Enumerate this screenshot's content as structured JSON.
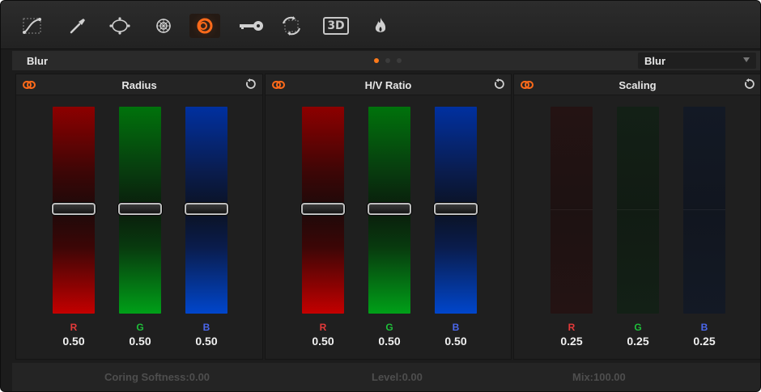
{
  "toolbar": {
    "tools": [
      {
        "icon": "curves-icon"
      },
      {
        "icon": "qualifier-picker-icon"
      },
      {
        "icon": "power-window-icon"
      },
      {
        "icon": "tracker-icon"
      },
      {
        "icon": "blur-icon",
        "active": true
      },
      {
        "icon": "key-icon"
      },
      {
        "icon": "sizing-icon"
      },
      {
        "icon": "3d-icon",
        "label": "3D"
      },
      {
        "icon": "flame-icon"
      }
    ],
    "active_color": "#ff6a1a"
  },
  "header": {
    "title": "Blur",
    "page_dots": 3,
    "active_dot": 0,
    "mode": "Blur"
  },
  "panels": [
    {
      "title": "Radius",
      "channels": [
        {
          "letter": "R",
          "value": "0.50"
        },
        {
          "letter": "G",
          "value": "0.50"
        },
        {
          "letter": "B",
          "value": "0.50"
        }
      ],
      "handle_level": 0.5,
      "enabled": true
    },
    {
      "title": "H/V Ratio",
      "channels": [
        {
          "letter": "R",
          "value": "0.50"
        },
        {
          "letter": "G",
          "value": "0.50"
        },
        {
          "letter": "B",
          "value": "0.50"
        }
      ],
      "handle_level": 0.5,
      "enabled": true
    },
    {
      "title": "Scaling",
      "channels": [
        {
          "letter": "R",
          "value": "0.25"
        },
        {
          "letter": "G",
          "value": "0.25"
        },
        {
          "letter": "B",
          "value": "0.25"
        }
      ],
      "enabled": false
    }
  ],
  "footer": {
    "coring_softness": "Coring Softness:0.00",
    "level": "Level:0.00",
    "mix": "Mix:100.00"
  },
  "colors": {
    "accent": "#ff6a1a",
    "red_channel": "#e43a3a",
    "green_channel": "#1fbf3a",
    "blue_channel": "#4b68ee"
  }
}
